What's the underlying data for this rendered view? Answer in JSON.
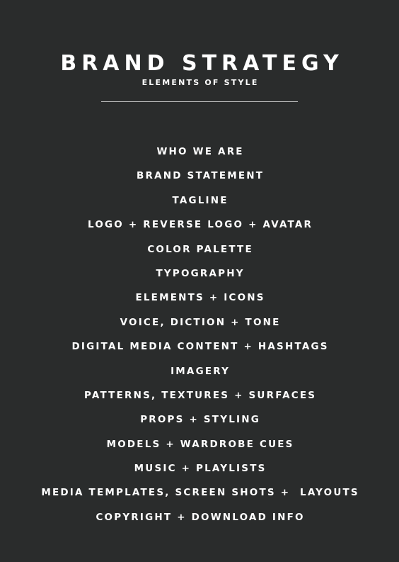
{
  "header": {
    "title": "BRAND STRATEGY",
    "subtitle": "ELEMENTS OF STYLE"
  },
  "contents": [
    "WHO WE ARE",
    "BRAND STATEMENT",
    "TAGLINE",
    "LOGO + REVERSE LOGO + AVATAR",
    "COLOR PALETTE",
    "TYPOGRAPHY",
    "ELEMENTS + ICONS",
    "VOICE, DICTION + TONE",
    "DIGITAL MEDIA CONTENT + HASHTAGS",
    "IMAGERY",
    "PATTERNS, TEXTURES + SURFACES",
    "PROPS + STYLING",
    "MODELS + WARDROBE CUES",
    "MUSIC + PLAYLISTS",
    "MEDIA TEMPLATES, SCREEN SHOTS +  LAYOUTS",
    "COPYRIGHT + DOWNLOAD INFO"
  ],
  "colors": {
    "background": "#2a2c2c",
    "text": "#ffffff",
    "divider": "#c8c8c8"
  }
}
